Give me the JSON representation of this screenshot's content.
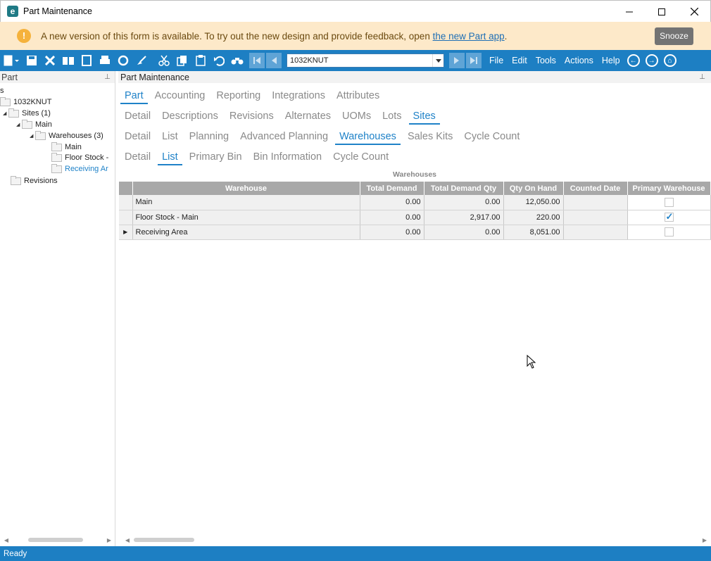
{
  "window": {
    "title": "Part Maintenance",
    "logo": "e"
  },
  "banner": {
    "message": "A new version of this form is available. To try out the new design and provide feedback, open ",
    "link": "the new Part app",
    "suffix": ".",
    "snooze": "Snooze"
  },
  "toolbar": {
    "part_value": "1032KNUT",
    "menus": {
      "file": "File",
      "edit": "Edit",
      "tools": "Tools",
      "actions": "Actions",
      "help": "Help"
    }
  },
  "left_panel": {
    "title": "Part",
    "tree": {
      "top": "s",
      "root": "1032KNUT",
      "sites": "Sites (1)",
      "main": "Main",
      "warehouses": "Warehouses (3)",
      "wh1": "Main",
      "wh2": "Floor Stock -",
      "wh3": "Receiving Ar",
      "revisions": "Revisions"
    }
  },
  "main": {
    "title": "Part Maintenance",
    "tabs_l1": [
      "Part",
      "Accounting",
      "Reporting",
      "Integrations",
      "Attributes"
    ],
    "tabs_l2": [
      "Detail",
      "Descriptions",
      "Revisions",
      "Alternates",
      "UOMs",
      "Lots",
      "Sites"
    ],
    "tabs_l3": [
      "Detail",
      "List",
      "Planning",
      "Advanced Planning",
      "Warehouses",
      "Sales Kits",
      "Cycle Count"
    ],
    "tabs_l4": [
      "Detail",
      "List",
      "Primary Bin",
      "Bin Information",
      "Cycle Count"
    ],
    "grid_title": "Warehouses",
    "columns": [
      "Warehouse",
      "Total Demand",
      "Total Demand Qty",
      "Qty On Hand",
      "Counted Date",
      "Primary Warehouse"
    ],
    "rows": [
      {
        "warehouse": "Main",
        "total_demand": "0.00",
        "total_demand_qty": "0.00",
        "qty_on_hand": "12,050.00",
        "counted_date": "",
        "primary": false
      },
      {
        "warehouse": "Floor Stock - Main",
        "total_demand": "0.00",
        "total_demand_qty": "2,917.00",
        "qty_on_hand": "220.00",
        "counted_date": "",
        "primary": true
      },
      {
        "warehouse": "Receiving Area",
        "total_demand": "0.00",
        "total_demand_qty": "0.00",
        "qty_on_hand": "8,051.00",
        "counted_date": "",
        "primary": false
      }
    ]
  },
  "status": {
    "text": "Ready"
  },
  "colors": {
    "accent": "#1d7fc3",
    "banner_bg": "#fde9c9",
    "active_tab": "#1f82c8"
  }
}
